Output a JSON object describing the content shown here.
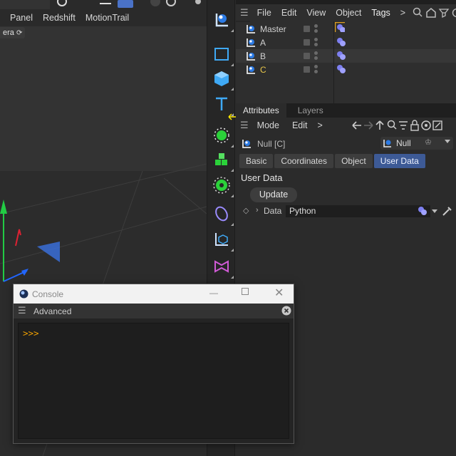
{
  "viewport": {
    "menus": [
      "Panel",
      "Redshift",
      "MotionTrail"
    ],
    "camera_label": "era"
  },
  "object_manager": {
    "menus": [
      "File",
      "Edit",
      "View",
      "Object",
      "Tags"
    ],
    "more": ">",
    "objects": [
      {
        "name": "Master",
        "color": "#d0d0d0"
      },
      {
        "name": "A",
        "color": "#d0d0d0"
      },
      {
        "name": "B",
        "color": "#d0d0d0"
      },
      {
        "name": "C",
        "color": "#e8c64b"
      }
    ]
  },
  "attributes": {
    "tabs": [
      "Attributes",
      "Layers"
    ],
    "menus": [
      "Mode",
      "Edit"
    ],
    "more": ">",
    "object_name": "Null [C]",
    "object_type": "Null",
    "object_tabs": [
      "Basic",
      "Coordinates",
      "Object",
      "User Data"
    ],
    "active_tab": "User Data",
    "section_title": "User Data",
    "update_label": "Update",
    "data_label": "Data",
    "data_value": "Python"
  },
  "console": {
    "title": "Console",
    "menu_label": "Advanced",
    "prompt": ">>>"
  },
  "colors": {
    "accent_blue": "#3d5a96",
    "tag_purple": "#7d7ff0",
    "selected_tag_border": "#e0a020",
    "prompt_orange": "#f0a000"
  }
}
